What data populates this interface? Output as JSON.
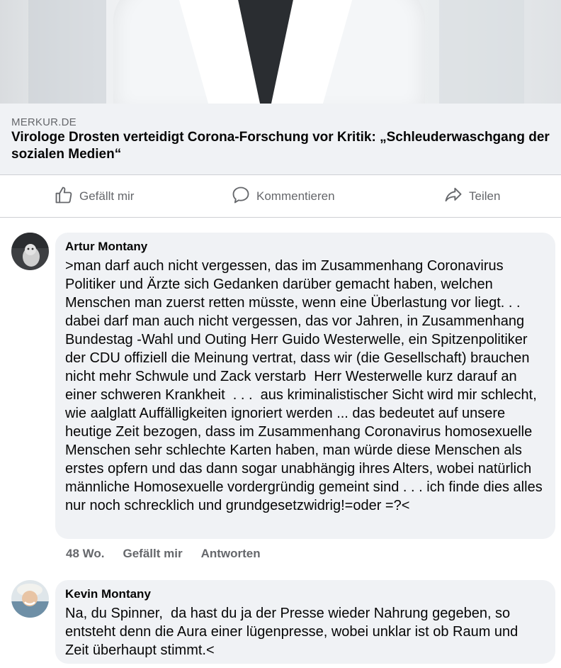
{
  "link": {
    "domain": "MERKUR.DE",
    "headline": "Virologe Drosten verteidigt Corona-Forschung vor Kritik: „Schleuderwaschgang der sozialen Medien“"
  },
  "actions": {
    "like": "Gefällt mir",
    "comment": "Kommentieren",
    "share": "Teilen"
  },
  "comments": [
    {
      "author": "Artur Montany",
      "text": ">man darf auch nicht vergessen, das im Zusammenhang Coronavirus Politiker und Ärzte sich Gedanken darüber gemacht haben, welchen Menschen man zuerst retten müsste, wenn eine Überlastung vor liegt. . . dabei darf man auch nicht vergessen, das vor Jahren, in Zusammenhang Bundestag -Wahl und Outing Herr Guido Westerwelle, ein Spitzenpolitiker der CDU offiziell die Meinung vertrat, dass wir (die Gesellschaft) brauchen nicht mehr Schwule und Zack verstarb  Herr Westerwelle kurz darauf an einer schweren Krankheit  . . .  aus kriminalistischer Sicht wird mir schlecht, wie aalglatt Auffälligkeiten ignoriert werden ... das bedeutet auf unsere heutige Zeit bezogen, dass im Zusammenhang Coronavirus homosexuelle Menschen sehr schlechte Karten haben, man würde diese Menschen als erstes opfern und das dann sogar unabhängig ihres Alters, wobei natürlich männliche Homosexuelle vordergründig gemeint sind . . . ich finde dies alles nur noch schrecklich und grundgesetzwidrig!=oder =?<",
      "time": "48 Wo.",
      "like": "Gefällt mir",
      "reply": "Antworten"
    },
    {
      "author": "Kevin Montany",
      "text": "Na, du Spinner,  da hast du ja der Presse wieder Nahrung gegeben, so entsteht denn die Aura einer lügenpresse, wobei unklar ist ob Raum und Zeit überhaupt stimmt.<"
    }
  ],
  "colors": {
    "secondary_text": "#65676b",
    "bubble_bg": "#f0f2f5",
    "divider": "#ced0d4"
  },
  "icons": [
    "thumbs-up-icon",
    "comment-icon",
    "share-icon"
  ]
}
